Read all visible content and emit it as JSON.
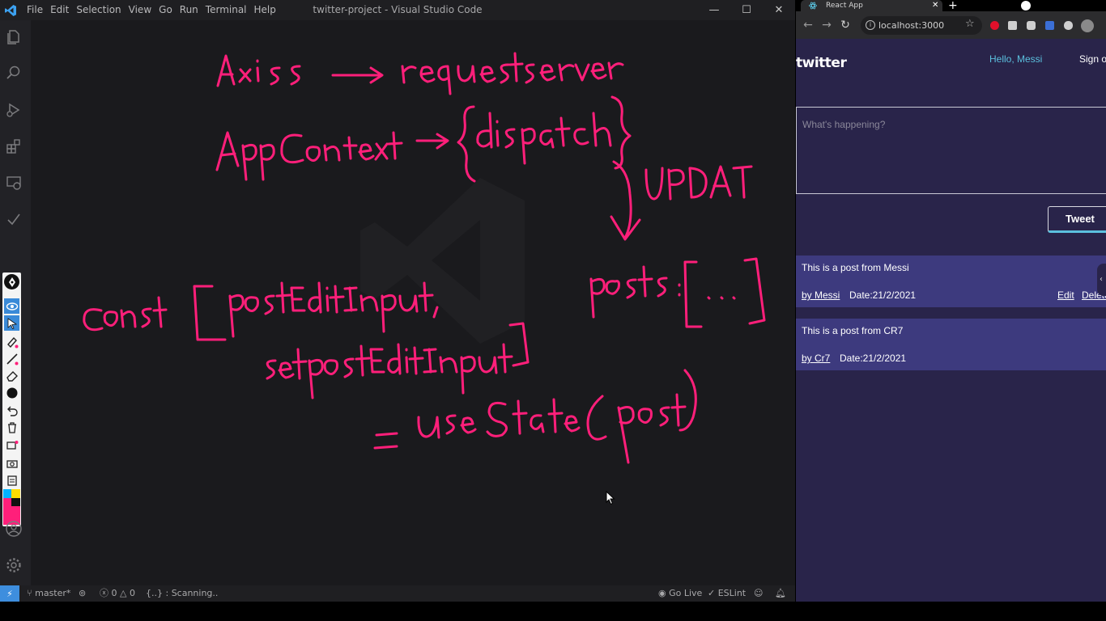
{
  "vscode": {
    "menu": [
      "File",
      "Edit",
      "Selection",
      "View",
      "Go",
      "Run",
      "Terminal",
      "Help"
    ],
    "title": "twitter-project - Visual Studio Code",
    "controls": {
      "minimize": "—",
      "maximize": "☐",
      "close": "✕"
    },
    "activity_icons": [
      "explorer-icon",
      "search-icon",
      "run-debug-icon",
      "extensions-icon",
      "remote-explorer-icon",
      "checkmark-icon",
      "account-icon",
      "settings-gear-icon"
    ],
    "pen_tools": [
      "pen-icon",
      "eye-icon",
      "pointer-icon",
      "highlighter-icon",
      "line-icon",
      "eraser-icon",
      "color-dot-icon",
      "undo-icon",
      "trash-icon",
      "screenshot-icon",
      "camera-icon",
      "clipboard-icon",
      "palette-icon"
    ],
    "whiteboard_lines": [
      "Axios → request server",
      "AppContext → {dispatch}",
      "UPDATE",
      "posts: [ ... ]",
      "const [postEditInput,",
      "setPostEditInput]",
      "= useState(post)"
    ],
    "ink_color": "#ff1f7a",
    "status": {
      "branch": "master*",
      "errors": "0",
      "warnings": "0",
      "scanning": "{..} : Scanning..",
      "go_live": "Go Live",
      "eslint": "ESLint"
    }
  },
  "browser": {
    "tab_title": "React App",
    "tab_close": "✕",
    "new_tab": "+",
    "url": "localhost:3000",
    "nav": {
      "back": "←",
      "forward": "→",
      "reload": "↻"
    },
    "star": "☆"
  },
  "app": {
    "brand": "twitter",
    "hello": "Hello, Messi",
    "sign_out": "Sign out",
    "tweet_placeholder": "What's happening?",
    "tweet_button": "Tweet",
    "posts": [
      {
        "text": "This is a post from Messi",
        "author": "by Messi",
        "date": "Date:21/2/2021",
        "edit": "Edit",
        "delete": "Delete"
      },
      {
        "text": "This is a post from CR7",
        "author": "by Cr7",
        "date": "Date:21/2/2021"
      }
    ],
    "colors": {
      "background": "#29244a",
      "post_bg": "#3d3a7e",
      "accent": "#5bc0de"
    }
  }
}
